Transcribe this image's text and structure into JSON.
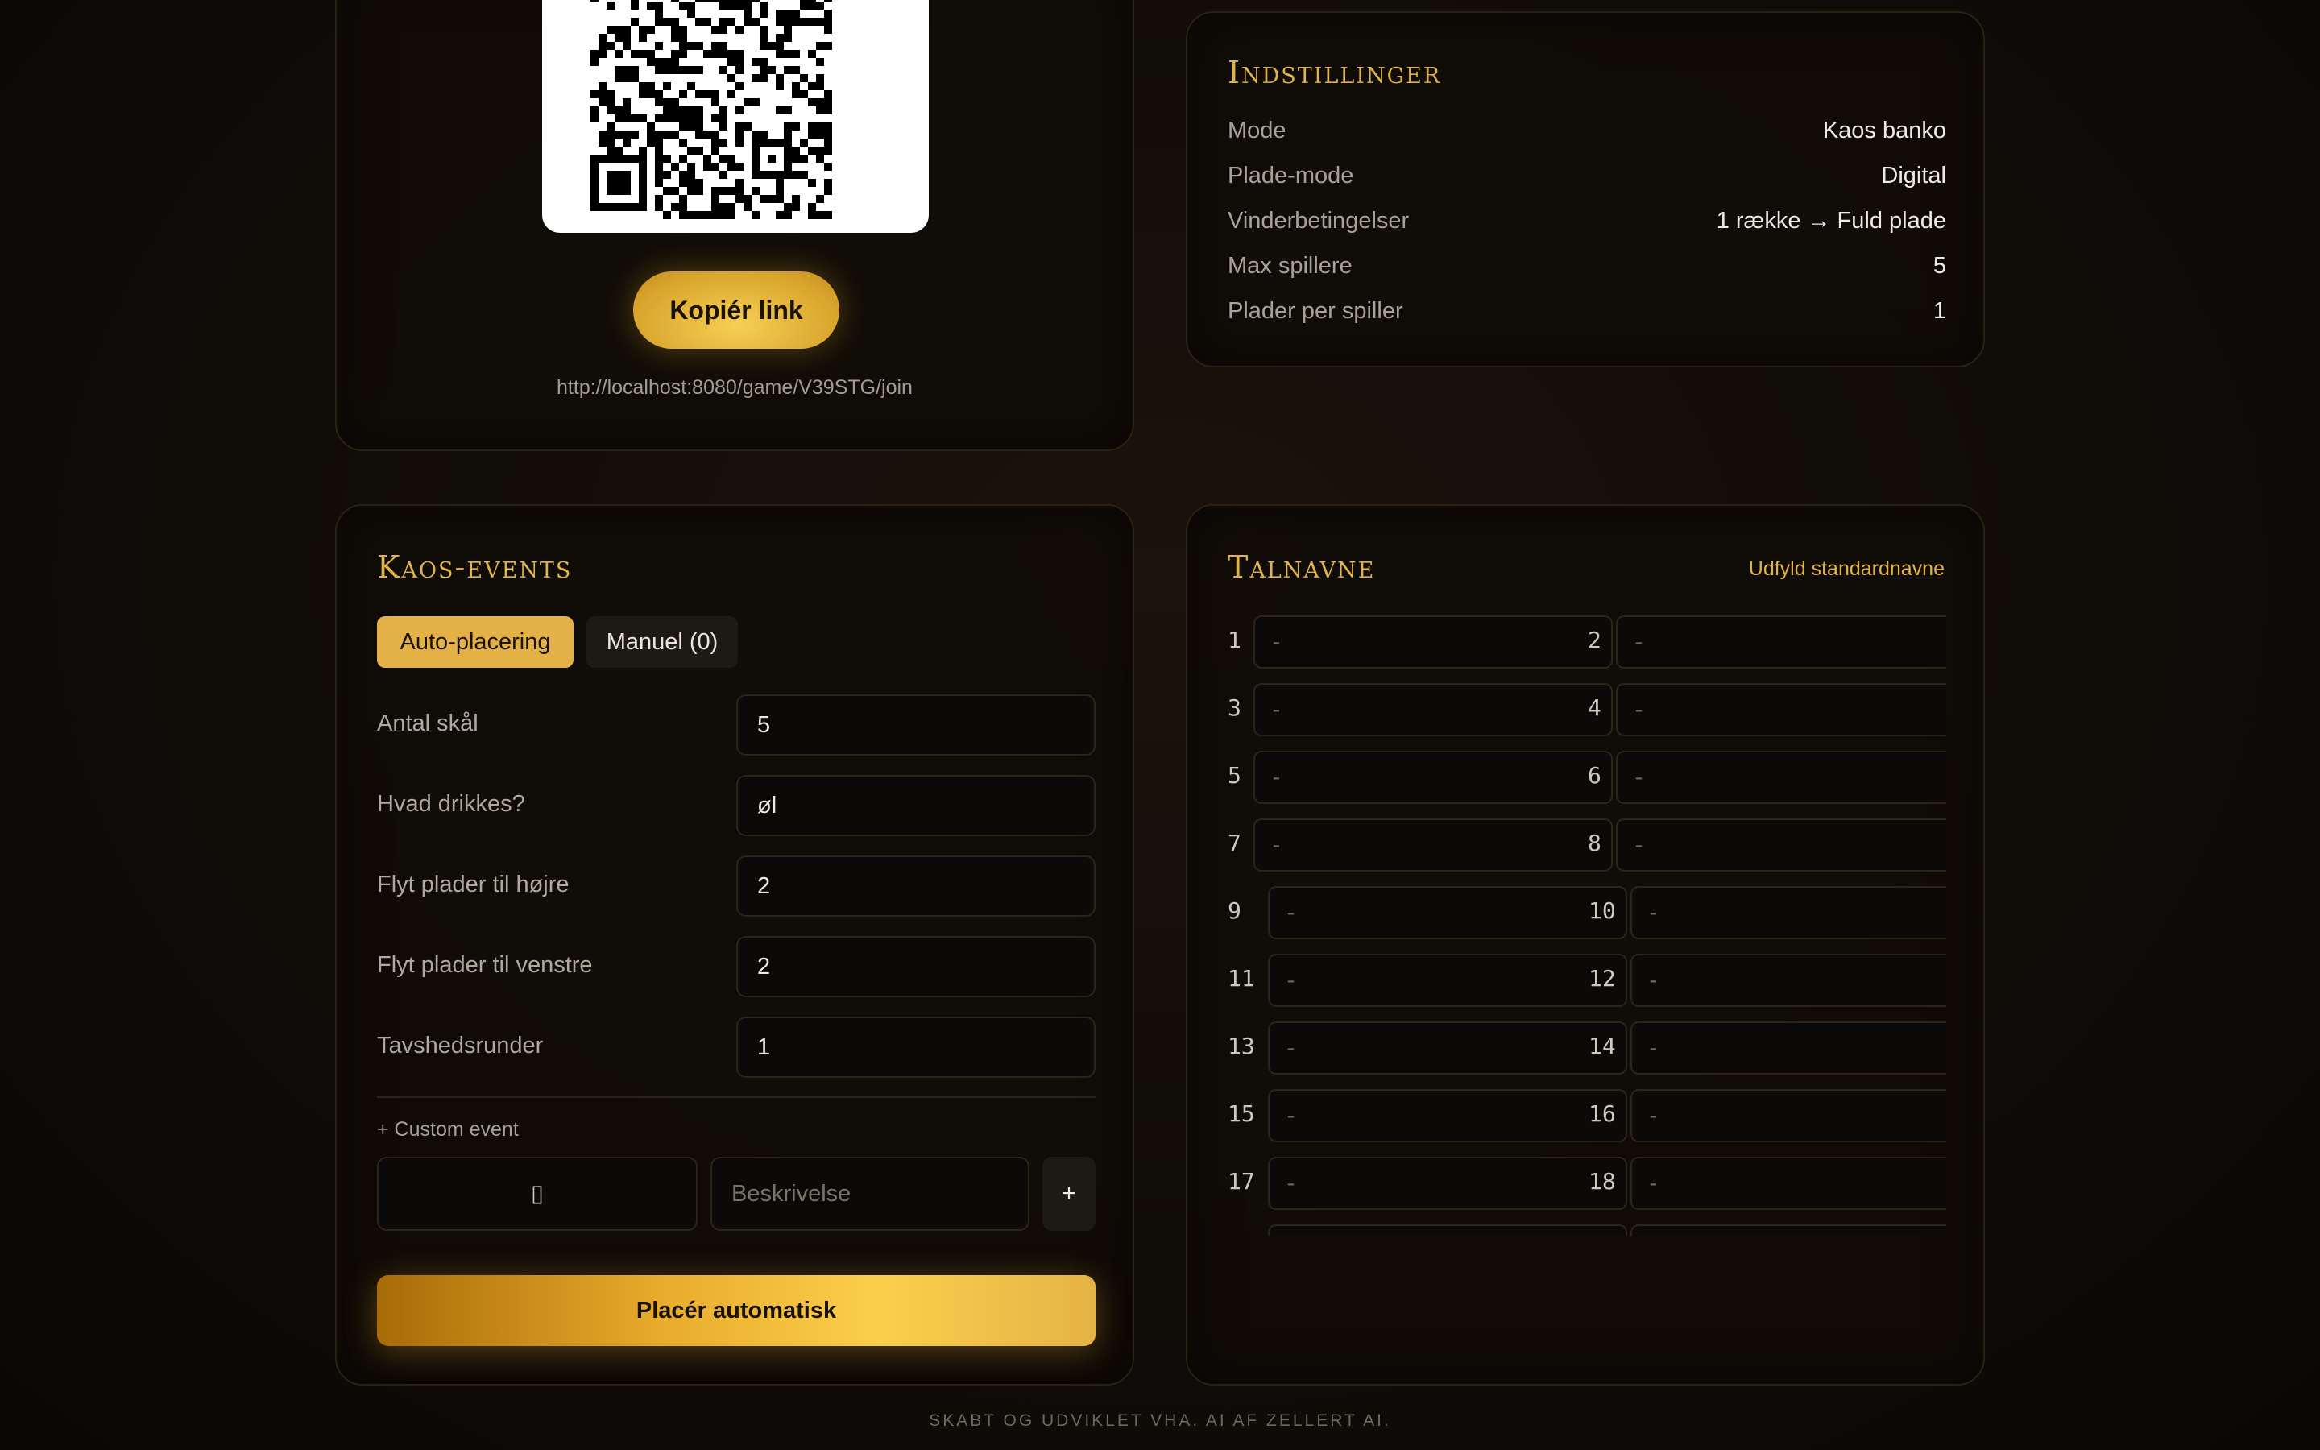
{
  "share": {
    "copy_label": "Kopiér link",
    "join_url": "http://localhost:8080/game/V39STG/join"
  },
  "settings": {
    "title": "Indstillinger",
    "rows": [
      {
        "key": "Mode",
        "value": "Kaos banko"
      },
      {
        "key": "Plade-mode",
        "value": "Digital"
      },
      {
        "key": "Vinderbetingelser",
        "value": "1 række → Fuld plade"
      },
      {
        "key": "Max spillere",
        "value": "5"
      },
      {
        "key": "Plader per spiller",
        "value": "1"
      }
    ]
  },
  "kaos": {
    "title": "Kaos-events",
    "tabs": [
      "Auto-placering",
      "Manuel (0)"
    ],
    "fields": [
      {
        "label": "Antal skål",
        "value": "5"
      },
      {
        "label": "Hvad drikkes?",
        "value": "øl"
      },
      {
        "label": "Flyt plader til højre",
        "value": "2"
      },
      {
        "label": "Flyt plader til venstre",
        "value": "2"
      },
      {
        "label": "Tavshedsrunder",
        "value": "1"
      }
    ],
    "custom_label": "+ Custom event",
    "custom_icon": "▯",
    "custom_desc_placeholder": "Beskrivelse",
    "add_label": "+",
    "auto_button": "Placér automatisk"
  },
  "numbers": {
    "title": "Talnavne",
    "fill_link": "Udfyld standardnavne",
    "placeholder": "-",
    "labels": [
      "1",
      "2",
      "3",
      "4",
      "5",
      "6",
      "7",
      "8",
      "9",
      "10",
      "11",
      "12",
      "13",
      "14",
      "15",
      "16",
      "17",
      "18"
    ]
  },
  "footer": "SKABT OG UDVIKLET VHA. AI AF ZELLERT AI."
}
